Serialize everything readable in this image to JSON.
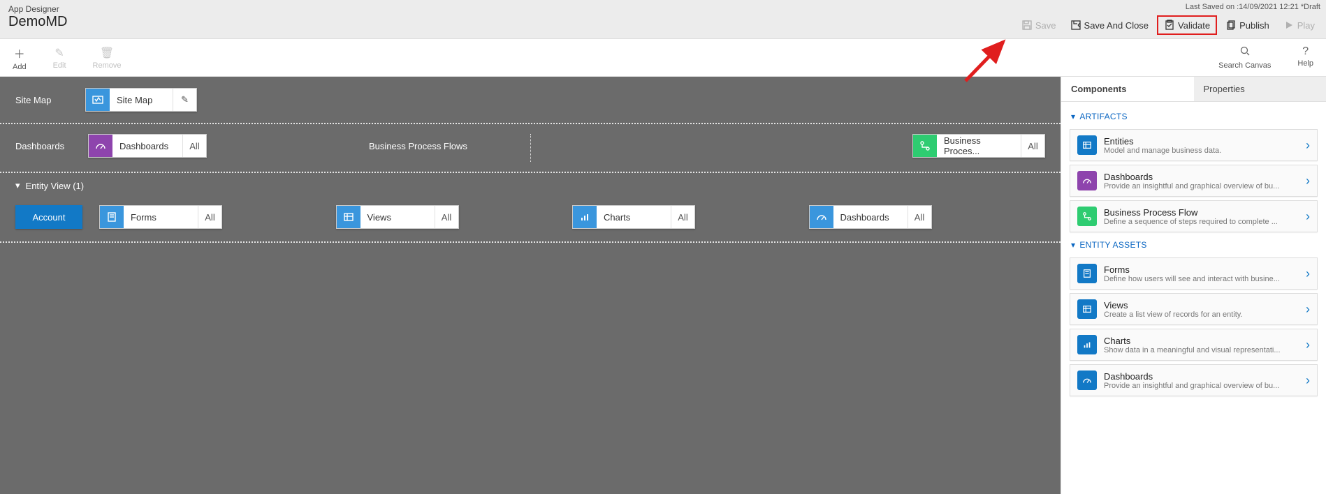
{
  "header": {
    "breadcrumb": "App Designer",
    "title": "DemoMD",
    "lastSaved": "Last Saved on :14/09/2021 12:21 *Draft",
    "buttons": {
      "save": "Save",
      "saveClose": "Save And Close",
      "validate": "Validate",
      "publish": "Publish",
      "play": "Play"
    }
  },
  "toolbar": {
    "add": "Add",
    "edit": "Edit",
    "remove": "Remove",
    "search": "Search Canvas",
    "help": "Help"
  },
  "canvas": {
    "siteMap": {
      "label": "Site Map",
      "card": "Site Map"
    },
    "dashboards": {
      "label": "Dashboards",
      "card": "Dashboards",
      "count": "All"
    },
    "bpf": {
      "label": "Business Process Flows",
      "card": "Business Proces...",
      "count": "All"
    },
    "entityView": {
      "label": "Entity View (1)"
    },
    "entity": {
      "name": "Account",
      "assets": [
        {
          "label": "Forms",
          "count": "All"
        },
        {
          "label": "Views",
          "count": "All"
        },
        {
          "label": "Charts",
          "count": "All"
        },
        {
          "label": "Dashboards",
          "count": "All"
        }
      ]
    }
  },
  "side": {
    "tabs": {
      "components": "Components",
      "properties": "Properties"
    },
    "artifacts": {
      "title": "ARTIFACTS",
      "items": [
        {
          "title": "Entities",
          "desc": "Model and manage business data.",
          "color": "blue",
          "icon": "grid"
        },
        {
          "title": "Dashboards",
          "desc": "Provide an insightful and graphical overview of bu...",
          "color": "purple",
          "icon": "gauge"
        },
        {
          "title": "Business Process Flow",
          "desc": "Define a sequence of steps required to complete ...",
          "color": "green",
          "icon": "flow"
        }
      ]
    },
    "assets": {
      "title": "ENTITY ASSETS",
      "items": [
        {
          "title": "Forms",
          "desc": "Define how users will see and interact with busine...",
          "icon": "form"
        },
        {
          "title": "Views",
          "desc": "Create a list view of records for an entity.",
          "icon": "grid"
        },
        {
          "title": "Charts",
          "desc": "Show data in a meaningful and visual representati...",
          "icon": "chart"
        },
        {
          "title": "Dashboards",
          "desc": "Provide an insightful and graphical overview of bu...",
          "icon": "gauge"
        }
      ]
    }
  }
}
